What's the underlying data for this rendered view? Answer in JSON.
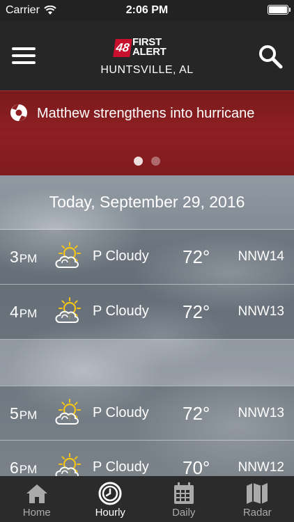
{
  "status_bar": {
    "carrier": "Carrier",
    "time": "2:06 PM"
  },
  "header": {
    "logo_number": "48",
    "logo_line1": "FIRST",
    "logo_line2": "ALERT",
    "location": "HUNTSVILLE, AL"
  },
  "alert": {
    "headline": "Matthew strengthens into hurricane",
    "pages": 2,
    "active_page": 1
  },
  "forecast": {
    "date": "Today, September 29, 2016",
    "hours": [
      {
        "hour": "3",
        "period": "PM",
        "icon": "partly-cloudy-icon",
        "condition": "P Cloudy",
        "temp": "72°",
        "wind": "NNW14"
      },
      {
        "hour": "4",
        "period": "PM",
        "icon": "partly-cloudy-icon",
        "condition": "P Cloudy",
        "temp": "72°",
        "wind": "NNW13"
      },
      {
        "hour": "5",
        "period": "PM",
        "icon": "partly-cloudy-icon",
        "condition": "P Cloudy",
        "temp": "72°",
        "wind": "NNW13"
      },
      {
        "hour": "6",
        "period": "PM",
        "icon": "partly-cloudy-icon",
        "condition": "P Cloudy",
        "temp": "70°",
        "wind": "NNW12"
      }
    ]
  },
  "tabs": [
    {
      "label": "Home",
      "icon": "home-icon",
      "active": false
    },
    {
      "label": "Hourly",
      "icon": "clock-icon",
      "active": true
    },
    {
      "label": "Daily",
      "icon": "calendar-icon",
      "active": false
    },
    {
      "label": "Radar",
      "icon": "map-icon",
      "active": false
    }
  ],
  "colors": {
    "header_bg": "#262626",
    "alert_bg": "#8e1f22",
    "logo_red": "#c8102e",
    "tabbar_bg": "#2b2b2b",
    "sun_yellow": "#f5c518"
  }
}
